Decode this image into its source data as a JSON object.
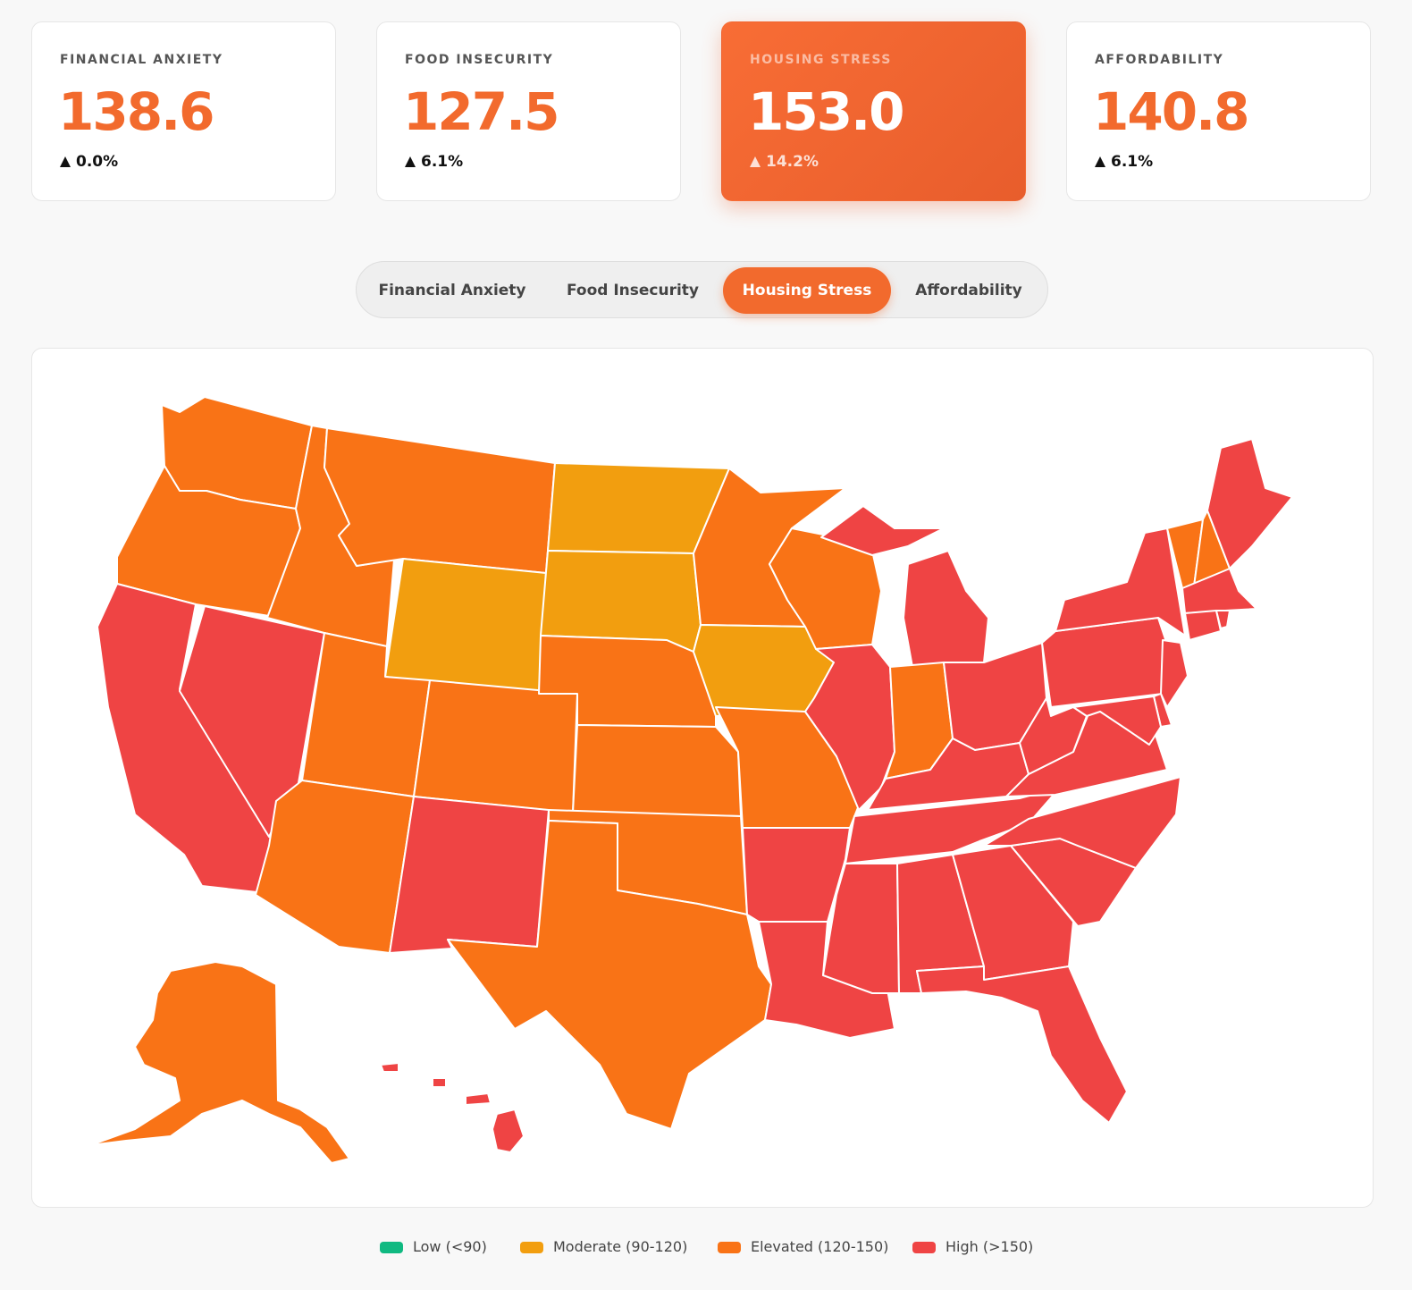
{
  "colors": {
    "accent": "#f26a2d",
    "low": "#10b981",
    "moderate": "#f29e0f",
    "elevated": "#f97316",
    "high": "#ef4444"
  },
  "cards": [
    {
      "label": "FINANCIAL ANXIETY",
      "value": "138.6",
      "change": "0.0%",
      "change_icon": "triangle-up"
    },
    {
      "label": "FOOD INSECURITY",
      "value": "127.5",
      "change": "6.1%",
      "change_icon": "triangle-up"
    },
    {
      "label": "HOUSING STRESS",
      "value": "153.0",
      "change": "14.2%",
      "change_icon": "triangle-up",
      "active": true
    },
    {
      "label": "AFFORDABILITY",
      "value": "140.8",
      "change": "6.1%",
      "change_icon": "triangle-up"
    }
  ],
  "tabs": [
    {
      "label": "Financial Anxiety"
    },
    {
      "label": "Food Insecurity"
    },
    {
      "label": "Housing Stress",
      "active": true
    },
    {
      "label": "Affordability"
    }
  ],
  "map": {
    "metric": "Housing Stress",
    "state_levels": {
      "WA": "elevated",
      "OR": "elevated",
      "CA": "high",
      "NV": "high",
      "ID": "elevated",
      "MT": "elevated",
      "WY": "moderate",
      "UT": "elevated",
      "AZ": "elevated",
      "CO": "elevated",
      "NM": "high",
      "ND": "moderate",
      "SD": "moderate",
      "NE": "elevated",
      "KS": "elevated",
      "OK": "elevated",
      "TX": "elevated",
      "MN": "elevated",
      "IA": "moderate",
      "MO": "elevated",
      "AR": "high",
      "LA": "high",
      "WI": "elevated",
      "IL": "high",
      "MI": "high",
      "IN": "elevated",
      "OH": "high",
      "KY": "high",
      "TN": "high",
      "MS": "high",
      "AL": "high",
      "GA": "high",
      "FL": "high",
      "SC": "high",
      "NC": "high",
      "VA": "high",
      "WV": "high",
      "PA": "high",
      "NY": "high",
      "VT": "elevated",
      "NH": "elevated",
      "ME": "high",
      "MA": "high",
      "CT": "high",
      "RI": "high",
      "NJ": "high",
      "DE": "high",
      "MD": "high",
      "AK": "elevated",
      "HI": "high"
    }
  },
  "legend": [
    {
      "label": "Low (<90)",
      "level": "low"
    },
    {
      "label": "Moderate (90-120)",
      "level": "moderate"
    },
    {
      "label": "Elevated (120-150)",
      "level": "elevated"
    },
    {
      "label": "High (>150)",
      "level": "high"
    }
  ]
}
